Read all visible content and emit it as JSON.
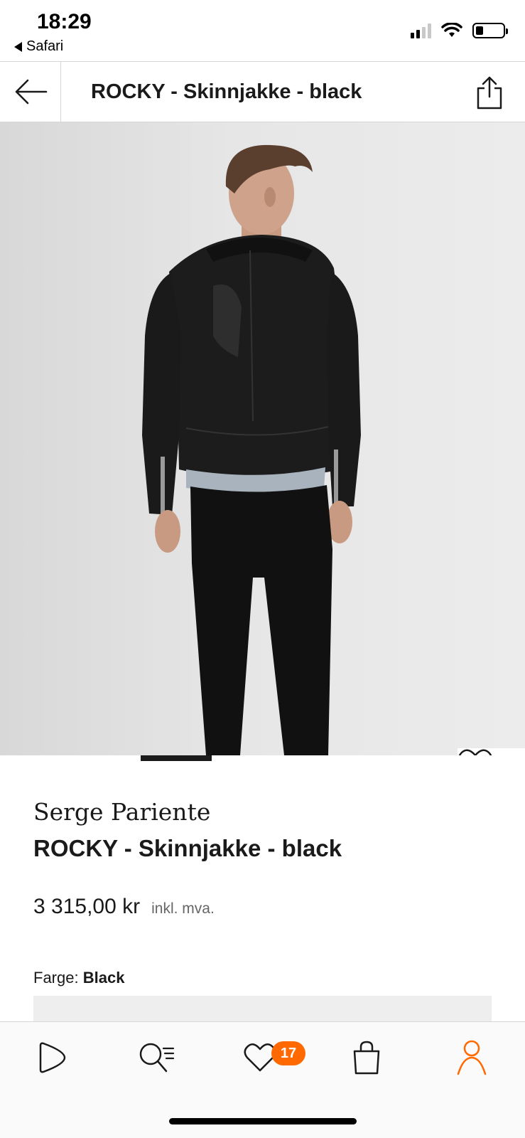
{
  "status_bar": {
    "time": "18:29",
    "back_app": "Safari"
  },
  "header": {
    "title": "ROCKY - Skinnjakke - black"
  },
  "gallery": {
    "image_alt": "Model wearing black leather biker jacket, back view",
    "active_index": 1,
    "total": 4
  },
  "product": {
    "brand": "Serge Pariente",
    "name": "ROCKY - Skinnjakke - black",
    "price": "3 315,00 kr",
    "vat_note": "inkl. mva.",
    "color_label": "Farge:",
    "color_value": "Black"
  },
  "tabbar": {
    "wishlist_count": "17"
  },
  "colors": {
    "accent": "#ff6900",
    "text": "#1a1a1a",
    "divider": "#d6d6d6"
  }
}
